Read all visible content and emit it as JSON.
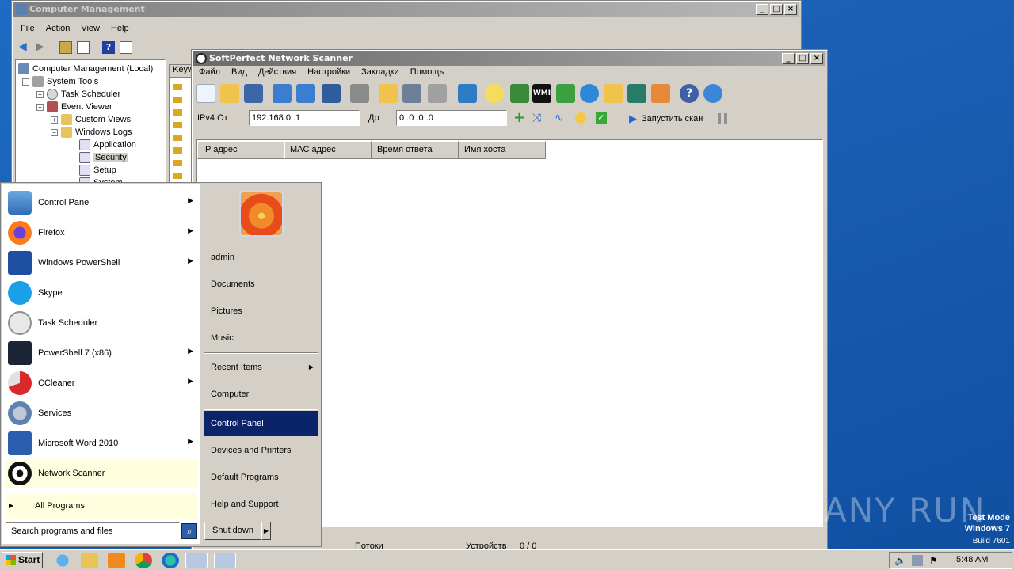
{
  "cm": {
    "title": "Computer Management",
    "menu": [
      "File",
      "Action",
      "View",
      "Help"
    ],
    "tree": {
      "root": "Computer Management (Local)",
      "system_tools": "System Tools",
      "task_scheduler": "Task Scheduler",
      "event_viewer": "Event Viewer",
      "custom_views": "Custom Views",
      "windows_logs": "Windows Logs",
      "application": "Application",
      "security": "Security",
      "setup": "Setup",
      "system": "System"
    },
    "list_header": "Keyw"
  },
  "ns": {
    "title": "SoftPerfect Network Scanner",
    "menu": [
      "Файл",
      "Вид",
      "Действия",
      "Настройки",
      "Закладки",
      "Помощь"
    ],
    "ipv4_from_label": "IPv4 От",
    "ip_from": "192.168.0 .1",
    "to_label": "До",
    "ip_to": "0 .0 .0 .0",
    "start_scan": "Запустить скан",
    "columns": [
      "IP адрес",
      "MAC адрес",
      "Время ответа",
      "Имя хоста"
    ],
    "status_left": "Потоки",
    "status_mid": "Устройств",
    "status_count": "0 / 0"
  },
  "start_menu": {
    "programs": [
      {
        "label": "Control Panel",
        "arrow": true
      },
      {
        "label": "Firefox",
        "arrow": true
      },
      {
        "label": "Windows PowerShell",
        "arrow": true
      },
      {
        "label": "Skype",
        "arrow": false
      },
      {
        "label": "Task Scheduler",
        "arrow": false
      },
      {
        "label": "PowerShell 7 (x86)",
        "arrow": true
      },
      {
        "label": "CCleaner",
        "arrow": true
      },
      {
        "label": "Services",
        "arrow": false
      },
      {
        "label": "Microsoft Word 2010",
        "arrow": true
      },
      {
        "label": "Network Scanner",
        "arrow": false
      }
    ],
    "all_programs": "All Programs",
    "search_placeholder": "Search programs and files",
    "right": {
      "user": "admin",
      "documents": "Documents",
      "pictures": "Pictures",
      "music": "Music",
      "recent_items": "Recent Items",
      "computer": "Computer",
      "control_panel": "Control Panel",
      "devices_printers": "Devices and Printers",
      "default_programs": "Default Programs",
      "help_support": "Help and Support"
    },
    "shutdown": "Shut down"
  },
  "taskbar": {
    "start": "Start",
    "time": "5:48 AM"
  },
  "watermark": {
    "line1": "Test Mode",
    "line2": "Windows 7",
    "line3": "Build 7601",
    "brand": "ANY RUN"
  }
}
